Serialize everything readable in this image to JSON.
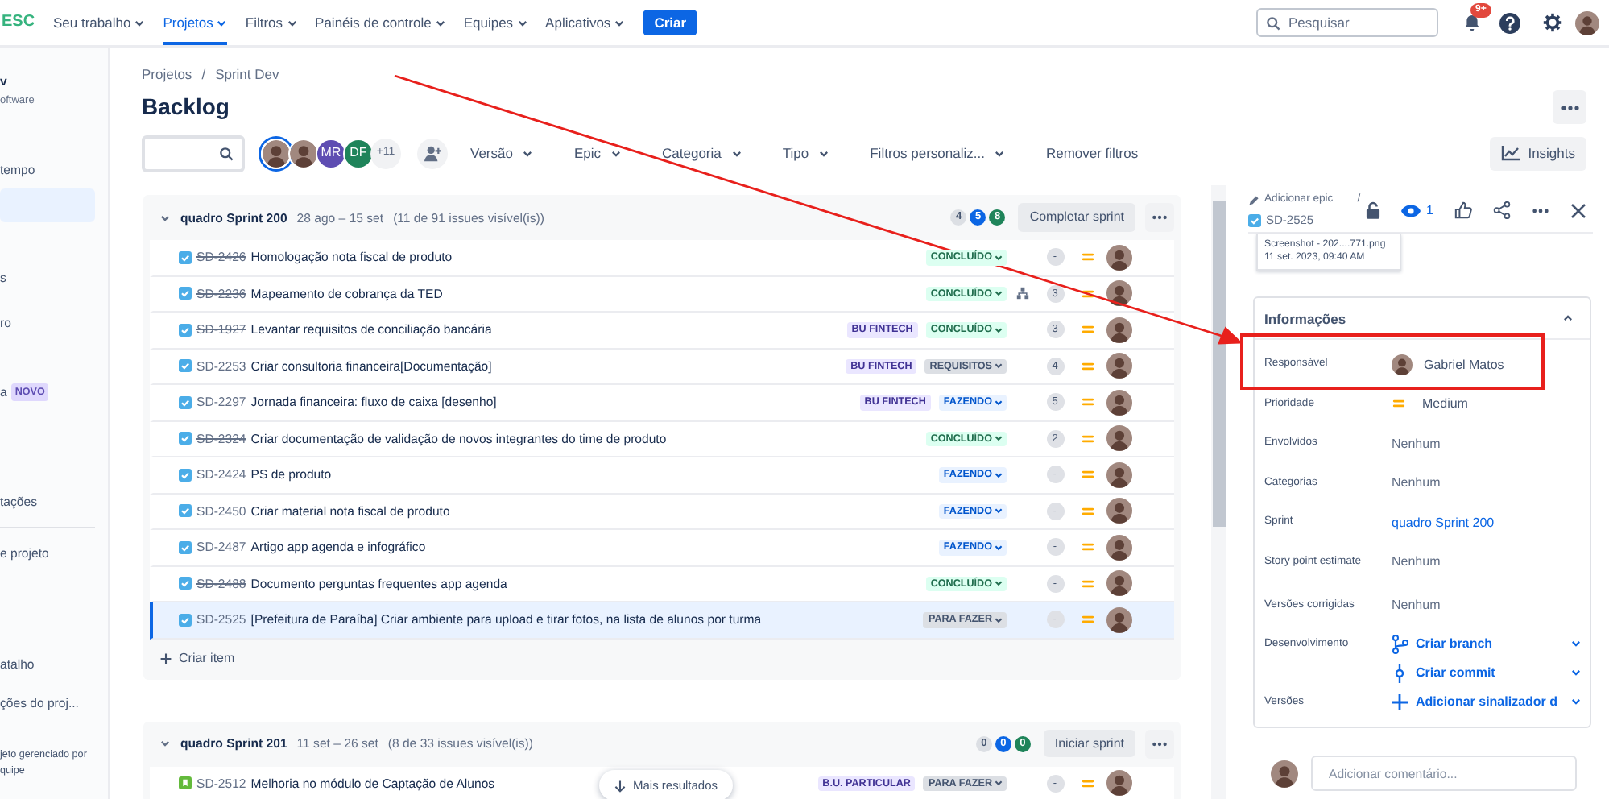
{
  "nav": {
    "logo": "ESC",
    "items": [
      {
        "label": "Seu trabalho",
        "selected": false
      },
      {
        "label": "Projetos",
        "selected": true
      },
      {
        "label": "Filtros",
        "selected": false
      },
      {
        "label": "Painéis de controle",
        "selected": false
      },
      {
        "label": "Equipes",
        "selected": false
      },
      {
        "label": "Aplicativos",
        "selected": false
      }
    ],
    "create": "Criar",
    "search_placeholder": "Pesquisar",
    "notifications": "9+"
  },
  "sidebar": {
    "items": [
      {
        "label": "v",
        "kind": "title"
      },
      {
        "label": "oftware",
        "kind": "caption"
      },
      {
        "label": "tempo",
        "kind": "link",
        "selected": false
      },
      {
        "kind": "link",
        "selected": true
      },
      {
        "label": "s",
        "kind": "link",
        "selected": false
      },
      {
        "label": "ro",
        "kind": "link",
        "selected": false
      },
      {
        "label": "a",
        "kind": "link",
        "selected": false,
        "badge": "NOVO"
      },
      {
        "label": "tações",
        "kind": "link",
        "selected": false
      },
      {
        "kind": "divider"
      },
      {
        "label": "e projeto",
        "kind": "link",
        "selected": false
      },
      {
        "label": "atalho",
        "kind": "link",
        "selected": false
      },
      {
        "label": "ções do proj...",
        "kind": "link",
        "selected": false
      },
      {
        "label": "jeto gerenciado por",
        "kind": "note"
      },
      {
        "label": "quipe",
        "kind": "note"
      }
    ]
  },
  "breadcrumb": {
    "items": [
      "Projetos",
      "Sprint Dev"
    ],
    "separator": "/"
  },
  "title": "Backlog",
  "filters": {
    "people": [
      {
        "kind": "photo",
        "selected": true
      },
      {
        "kind": "photo",
        "selected": false
      },
      {
        "kind": "initials",
        "initials": "MR",
        "color": "#5e4db2",
        "selected": false
      },
      {
        "kind": "initials",
        "initials": "DF",
        "color": "#1f845a",
        "selected": false
      }
    ],
    "more_people": "+11",
    "dropdowns": [
      "Versão",
      "Epic",
      "Categoria",
      "Tipo",
      "Filtros personaliz..."
    ],
    "clear": "Remover filtros",
    "insights": "Insights"
  },
  "sprints": [
    {
      "name": "quadro Sprint 200",
      "dates": "28 ago – 15 set",
      "count": "(11 de 91 issues visível(is))",
      "counts": [
        {
          "value": "4",
          "kind": "todo"
        },
        {
          "value": "5",
          "kind": "doing"
        },
        {
          "value": "8",
          "kind": "done"
        }
      ],
      "action": "Completar sprint",
      "create": "Criar item",
      "rows": [
        {
          "kind": "task",
          "key": "SD-2426",
          "struck": true,
          "summary": "Homologação nota fiscal de produto",
          "status": {
            "label": "CONCLUÍDO",
            "kind": "done"
          },
          "has_children": false,
          "points": "-",
          "selected": false
        },
        {
          "kind": "task",
          "key": "SD-2236",
          "struck": true,
          "summary": "Mapeamento de cobrança da TED",
          "status": {
            "label": "CONCLUÍDO",
            "kind": "done"
          },
          "has_children": true,
          "points": "3",
          "selected": false
        },
        {
          "kind": "task",
          "key": "SD-1927",
          "struck": true,
          "summary": "Levantar requisitos de conciliação bancária",
          "label": "BU FINTECH",
          "status": {
            "label": "CONCLUÍDO",
            "kind": "done"
          },
          "has_children": false,
          "points": "3",
          "selected": false
        },
        {
          "kind": "task",
          "key": "SD-2253",
          "struck": false,
          "summary": "Criar consultoria financeira[Documentação]",
          "label": "BU FINTECH",
          "status": {
            "label": "REQUISITOS",
            "kind": "todo"
          },
          "has_children": false,
          "points": "4",
          "selected": false
        },
        {
          "kind": "task",
          "key": "SD-2297",
          "struck": false,
          "summary": "Jornada financeira: fluxo de caixa [desenho]",
          "label": "BU FINTECH",
          "status": {
            "label": "FAZENDO",
            "kind": "doing"
          },
          "has_children": false,
          "points": "5",
          "selected": false
        },
        {
          "kind": "task",
          "key": "SD-2324",
          "struck": true,
          "summary": "Criar documentação de validação de novos integrantes do time de produto",
          "status": {
            "label": "CONCLUÍDO",
            "kind": "done"
          },
          "has_children": false,
          "points": "2",
          "selected": false
        },
        {
          "kind": "task",
          "key": "SD-2424",
          "struck": false,
          "summary": "PS de produto",
          "status": {
            "label": "FAZENDO",
            "kind": "doing"
          },
          "has_children": false,
          "points": "-",
          "selected": false
        },
        {
          "kind": "task",
          "key": "SD-2450",
          "struck": false,
          "summary": "Criar material nota fiscal de produto",
          "status": {
            "label": "FAZENDO",
            "kind": "doing"
          },
          "has_children": false,
          "points": "-",
          "selected": false
        },
        {
          "kind": "task",
          "key": "SD-2487",
          "struck": false,
          "summary": "Artigo app agenda e infográfico",
          "status": {
            "label": "FAZENDO",
            "kind": "doing"
          },
          "has_children": false,
          "points": "-",
          "selected": false
        },
        {
          "kind": "task",
          "key": "SD-2488",
          "struck": true,
          "summary": "Documento perguntas frequentes app agenda",
          "status": {
            "label": "CONCLUÍDO",
            "kind": "done"
          },
          "has_children": false,
          "points": "-",
          "selected": false
        },
        {
          "kind": "task",
          "key": "SD-2525",
          "struck": false,
          "summary": "[Prefeitura de Paraíba] Criar ambiente para upload e tirar fotos, na lista de alunos por turma",
          "status": {
            "label": "PARA FAZER",
            "kind": "todo"
          },
          "has_children": false,
          "points": "-",
          "selected": true
        }
      ]
    },
    {
      "name": "quadro Sprint 201",
      "dates": "11 set – 26 set",
      "count": "(8 de 33 issues visível(is))",
      "counts": [
        {
          "value": "0",
          "kind": "todo"
        },
        {
          "value": "0",
          "kind": "doing"
        },
        {
          "value": "0",
          "kind": "done"
        }
      ],
      "action": "Iniciar sprint",
      "rows": [
        {
          "kind": "story",
          "key": "SD-2512",
          "struck": false,
          "summary": "Melhoria no módulo de Captação de Alunos",
          "label": "B.U. PARTICULAR",
          "status": {
            "label": "PARA FAZER",
            "kind": "todo"
          },
          "has_children": false,
          "points": "-",
          "selected": false
        }
      ]
    }
  ],
  "more_results": "Mais resultados",
  "detail": {
    "epic": "Adicionar epic",
    "separator": "/",
    "key": "SD-2525",
    "watchers": "1",
    "attachment": {
      "name": "Screenshot - 202....771.png",
      "date": "11 set. 2023, 09:40 AM"
    },
    "section": "Informações",
    "fields": [
      {
        "label": "Responsável",
        "kind": "user",
        "value": "Gabriel Matos"
      },
      {
        "label": "Prioridade",
        "kind": "priority",
        "value": "Medium"
      },
      {
        "label": "Envolvidos",
        "kind": "empty",
        "value": "Nenhum"
      },
      {
        "label": "Categorias",
        "kind": "empty",
        "value": "Nenhum"
      },
      {
        "label": "Sprint",
        "kind": "link",
        "value": "quadro Sprint 200"
      },
      {
        "label": "Story point estimate",
        "kind": "empty",
        "value": "Nenhum"
      },
      {
        "label": "Versões corrigidas",
        "kind": "empty",
        "value": "Nenhum"
      },
      {
        "label": "Desenvolvimento",
        "kind": "actions",
        "actions": [
          {
            "label": "Criar branch",
            "kind": "branch"
          },
          {
            "label": "Criar commit",
            "kind": "commit"
          }
        ]
      },
      {
        "label": "Versões",
        "kind": "actions",
        "actions": [
          {
            "label": "Adicionar sinalizador d",
            "kind": "add"
          }
        ]
      }
    ],
    "comment_placeholder": "Adicionar comentário..."
  }
}
